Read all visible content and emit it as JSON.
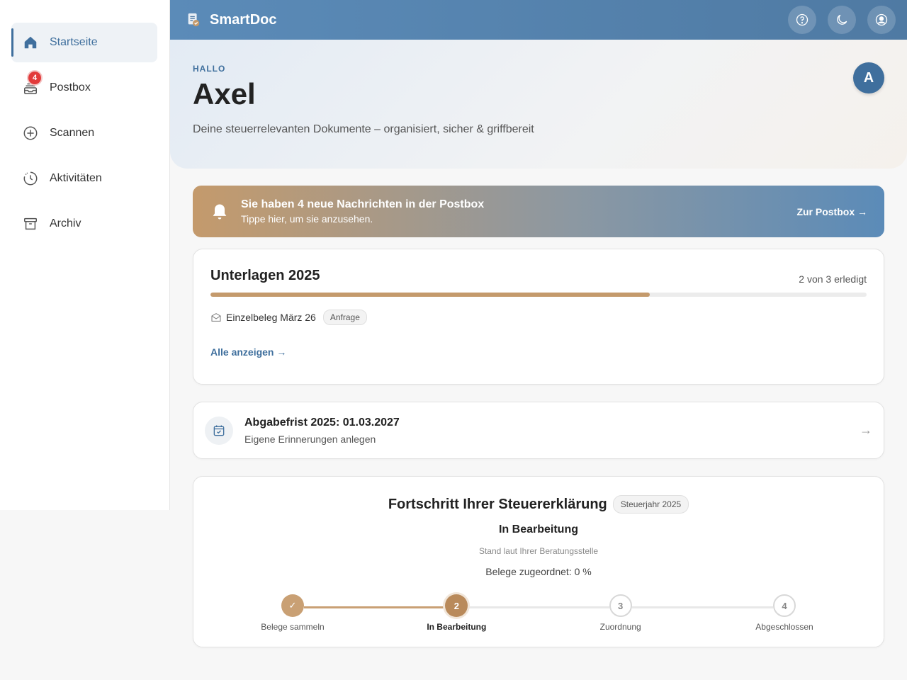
{
  "sidebar": {
    "items": [
      {
        "label": "Startseite",
        "icon": "home-icon",
        "active": true
      },
      {
        "label": "Postbox",
        "icon": "inbox-icon",
        "badge": "4"
      },
      {
        "label": "Scannen",
        "icon": "plus-circle-icon"
      },
      {
        "label": "Aktivitäten",
        "icon": "clock-icon"
      },
      {
        "label": "Archiv",
        "icon": "archive-icon"
      }
    ]
  },
  "header": {
    "app_title": "SmartDoc",
    "actions": [
      "help-icon",
      "moon-icon",
      "user-icon"
    ]
  },
  "hero": {
    "greeting": "HALLO",
    "name": "Axel",
    "subtitle": "Deine steuerrelevanten Dokumente – organisiert, sicher & griffbereit",
    "avatar_initial": "A"
  },
  "banner": {
    "title": "Sie haben 4 neue Nachrichten in der Postbox",
    "subtitle": "Tippe hier, um sie anzusehen.",
    "link": "Zur Postbox →"
  },
  "documents": {
    "title": "Unterlagen 2025",
    "count_label": "2 von 3 erledigt",
    "progress": 0.67,
    "items": [
      {
        "label": "Einzelbeleg März 26",
        "tag": "Anfrage"
      }
    ],
    "show_all": "Alle anzeigen →"
  },
  "deadline": {
    "title": "Abgabefrist 2025: 01.03.2027",
    "subtitle": "Eigene Erinnerungen anlegen",
    "arrow": "→"
  },
  "tax_progress": {
    "title": "Fortschritt Ihrer Steuererklärung",
    "year_tag": "Steuerjahr 2025",
    "status": "In Bearbeitung",
    "note": "Stand laut Ihrer Beratungsstelle",
    "assigned": "Belege zugeordnet: 0 %",
    "steps": [
      {
        "label": "Belege sammeln",
        "marker": "✓",
        "state": "done"
      },
      {
        "label": "In Bearbeitung",
        "marker": "2",
        "state": "current"
      },
      {
        "label": "Zuordnung",
        "marker": "3",
        "state": "todo"
      },
      {
        "label": "Abgeschlossen",
        "marker": "4",
        "state": "todo"
      }
    ]
  },
  "colors": {
    "primary": "#3f6f9d",
    "accent": "#c49a6c",
    "badge": "#e23b3b"
  }
}
